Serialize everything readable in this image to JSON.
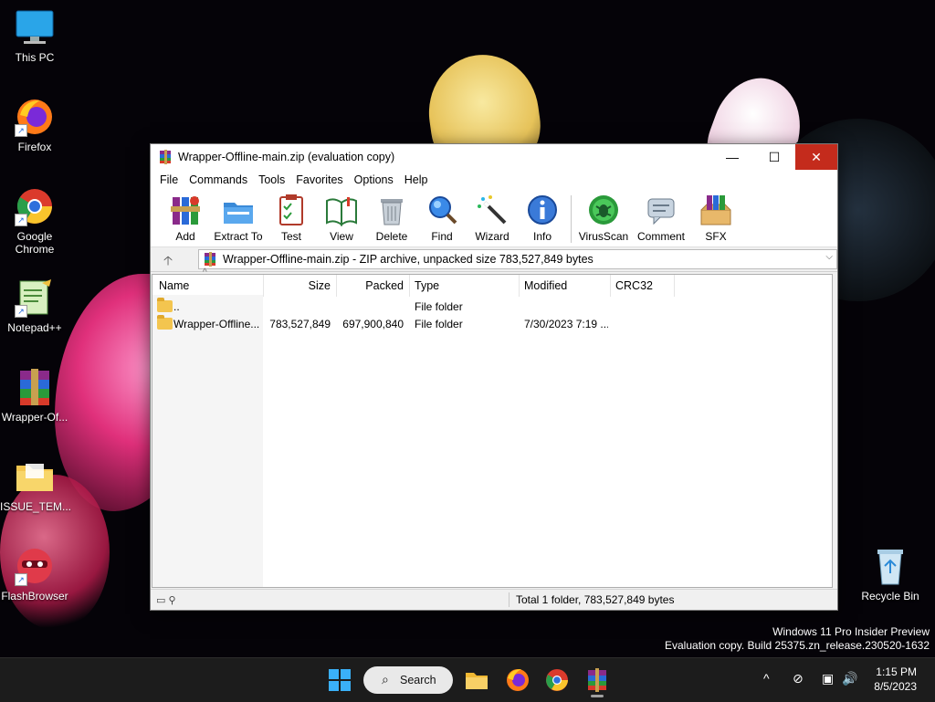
{
  "desktop": {
    "icons": [
      {
        "label": "This PC"
      },
      {
        "label": "Firefox"
      },
      {
        "label": "Google Chrome"
      },
      {
        "label": "Notepad++"
      },
      {
        "label": "Wrapper-Of..."
      },
      {
        "label": "ISSUE_TEM..."
      },
      {
        "label": "FlashBrowser"
      },
      {
        "label": "Recycle Bin"
      }
    ],
    "shortcut_glyph": "↗"
  },
  "window": {
    "title": "Wrapper-Offline-main.zip (evaluation copy)",
    "controls": {
      "minimize": "—",
      "maximize": "☐",
      "close": "✕"
    },
    "menu": [
      "File",
      "Commands",
      "Tools",
      "Favorites",
      "Options",
      "Help"
    ],
    "toolbar": [
      {
        "label": "Add",
        "icon": "add-archive-icon"
      },
      {
        "label": "Extract To",
        "icon": "extract-folder-icon"
      },
      {
        "label": "Test",
        "icon": "test-clipboard-icon"
      },
      {
        "label": "View",
        "icon": "book-icon"
      },
      {
        "label": "Delete",
        "icon": "trash-icon"
      },
      {
        "label": "Find",
        "icon": "magnifier-icon"
      },
      {
        "label": "Wizard",
        "icon": "magic-wand-icon"
      },
      {
        "label": "Info",
        "icon": "info-icon"
      },
      {
        "label": "VirusScan",
        "icon": "bug-icon"
      },
      {
        "label": "Comment",
        "icon": "comment-icon"
      },
      {
        "label": "SFX",
        "icon": "sfx-box-icon"
      }
    ],
    "address": {
      "up": "🡡",
      "text": "Wrapper-Offline-main.zip - ZIP archive, unpacked size 783,527,849 bytes",
      "dropdown": "⌵"
    },
    "columns": {
      "name": "Name",
      "size": "Size",
      "packed": "Packed",
      "type": "Type",
      "modified": "Modified",
      "crc": "CRC32"
    },
    "sort_caret": "^",
    "rows": [
      {
        "name": "..",
        "size": "",
        "packed": "",
        "type": "File folder",
        "modified": "",
        "crc": ""
      },
      {
        "name": "Wrapper-Offline...",
        "size": "783,527,849",
        "packed": "697,900,840",
        "type": "File folder",
        "modified": "7/30/2023 7:19 ...",
        "crc": ""
      }
    ],
    "status": {
      "icons": "▭ ⚲",
      "text": "Total 1 folder, 783,527,849 bytes"
    }
  },
  "watermark": {
    "line1": "Windows 11 Pro Insider Preview",
    "line2": "Evaluation copy. Build 25375.zn_release.230520-1632"
  },
  "taskbar": {
    "search_label": "Search",
    "search_glyph": "⌕",
    "tray": {
      "chevron": "^",
      "network": "⊘",
      "display": "▣",
      "volume": "🔊"
    },
    "time": "1:15 PM",
    "date": "8/5/2023"
  }
}
